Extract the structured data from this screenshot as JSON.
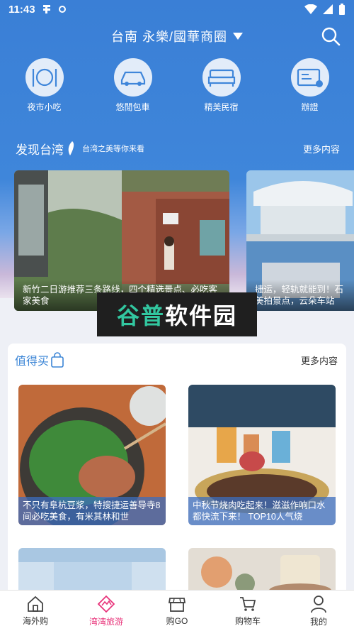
{
  "status_bar": {
    "time": "11:43"
  },
  "header": {
    "location": "台南 永樂/國華商圈"
  },
  "categories": [
    {
      "label": "夜市小吃",
      "icon": "dining-icon"
    },
    {
      "label": "悠閒包車",
      "icon": "car-icon"
    },
    {
      "label": "精美民宿",
      "icon": "bed-icon"
    },
    {
      "label": "辦證",
      "icon": "id-card-icon"
    }
  ],
  "discover": {
    "title": "发现台湾",
    "subtitle": "台湾之美等你来看",
    "more": "更多内容",
    "cards": [
      {
        "caption": "新竹二日游推荐三条路线，四个精选景点、必吃客家美食"
      },
      {
        "caption": "捷运，轻轨就能到！石美拍景点，云朵车站"
      }
    ]
  },
  "watermark": {
    "text_1": "谷普",
    "text_2": "软件园"
  },
  "worth_buying": {
    "title": "值得买",
    "more": "更多内容",
    "items": [
      {
        "caption": "不只有阜杭豆浆，特搜捷运善导寺8间必吃美食，有米其林和世"
      },
      {
        "caption": "中秋节烧肉吃起来！滋滋作响口水都快流下来！ TOP10人气烧"
      }
    ]
  },
  "bottom_nav": [
    {
      "label": "海外购",
      "icon": "home-icon"
    },
    {
      "label": "湾湾旅游",
      "icon": "travel-icon"
    },
    {
      "label": "购GO",
      "icon": "store-icon"
    },
    {
      "label": "购物车",
      "icon": "cart-icon"
    },
    {
      "label": "我的",
      "icon": "user-icon"
    }
  ],
  "colors": {
    "primary_blue": "#3f86da",
    "active_pink": "#e8337a"
  }
}
